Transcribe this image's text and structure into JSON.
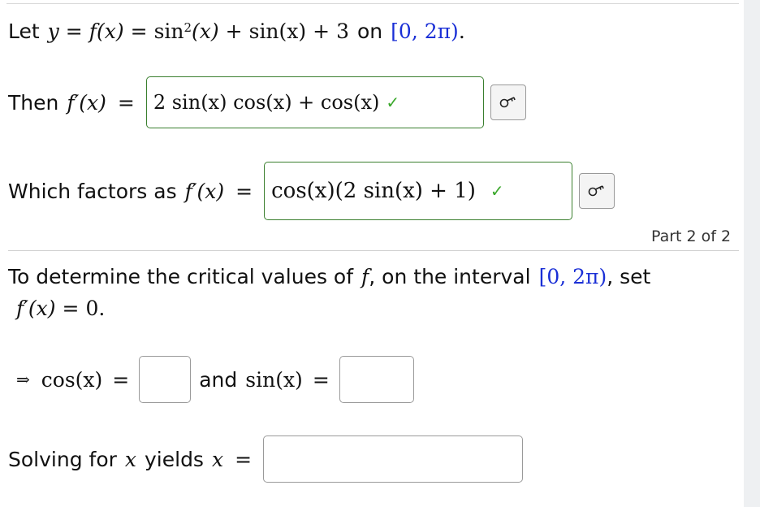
{
  "intro": {
    "prefix": "Let",
    "y": "y",
    "eq": "=",
    "fx": "f(x)",
    "sin2": "sin",
    "sup": "2",
    "arg": "(x)",
    "plus1": "+",
    "sinx": "sin(x)",
    "plus2": "+",
    "three": "3",
    "on": "on",
    "interval": "[0, 2π)",
    "period": "."
  },
  "derivative": {
    "prefix": "Then",
    "fprime": "f′(x)",
    "eq": "=",
    "answer": "2 sin(x) cos(x) + cos(x)",
    "status": "✓",
    "keyboard_icon": "keyboard-icon"
  },
  "factored": {
    "prefix": "Which factors as",
    "fprime": "f′(x)",
    "eq": "=",
    "answer": "cos(x)(2 sin(x) + 1)",
    "status": "✓",
    "keyboard_icon": "keyboard-icon"
  },
  "part_label": "Part 2 of 2",
  "critical": {
    "text1": "To determine the critical values of",
    "f": "f",
    "text2": ", on the interval",
    "interval": "[0, 2π)",
    "text3": ", set",
    "fprime": "f′(x)",
    "eq": "=",
    "zero": "0",
    "period": "."
  },
  "equations": {
    "arrow": "⇒",
    "cosx": "cos(x)",
    "eq1": "=",
    "cos_value": "",
    "and": "and",
    "sinx": "sin(x)",
    "eq2": "=",
    "sin_value": ""
  },
  "solving": {
    "prefix": "Solving for",
    "x": "x",
    "yields": "yields",
    "x2": "x",
    "eq": "=",
    "value": ""
  }
}
